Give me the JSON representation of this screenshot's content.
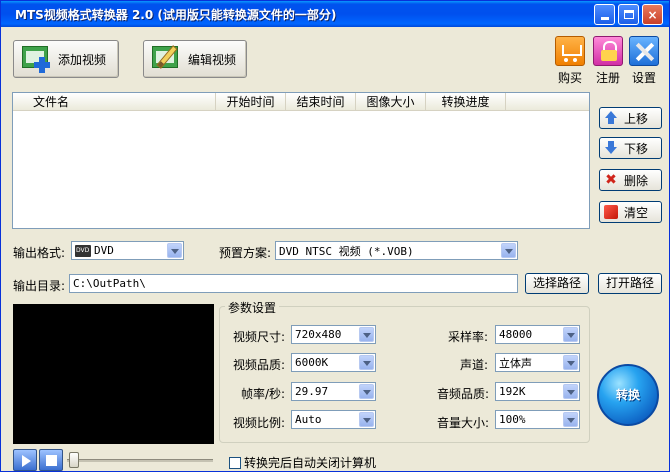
{
  "window": {
    "title": "MTS视频格式转换器 2.0 (试用版只能转换源文件的一部分)",
    "controls": {
      "minimize": "",
      "maximize": "",
      "close": "×"
    }
  },
  "toolbar": {
    "add_video": "添加视频",
    "edit_video": "编辑视频",
    "buy": "购买",
    "register": "注册",
    "settings": "设置"
  },
  "filelist": {
    "columns": [
      "文件名",
      "开始时间",
      "结束时间",
      "图像大小",
      "转换进度"
    ],
    "rows": []
  },
  "side_buttons": {
    "up": "上移",
    "down": "下移",
    "delete": "删除",
    "clear": "清空"
  },
  "output": {
    "format_label": "输出格式:",
    "format_value": "DVD",
    "preset_label": "预置方案:",
    "preset_value": "DVD NTSC 视频  (*.VOB)",
    "dir_label": "输出目录:",
    "dir_value": "C:\\OutPath\\",
    "choose_path": "选择路径",
    "open_path": "打开路径"
  },
  "params": {
    "title": "参数设置",
    "video_size_label": "视频尺寸:",
    "video_size": "720x480",
    "video_quality_label": "视频品质:",
    "video_quality": "6000K",
    "framerate_label": "帧率/秒:",
    "framerate": "29.97",
    "aspect_label": "视频比例:",
    "aspect": "Auto",
    "samplerate_label": "采样率:",
    "samplerate": "48000",
    "channels_label": "声道:",
    "channels": "立体声",
    "audio_quality_label": "音频品质:",
    "audio_quality": "192K",
    "volume_label": "音量大小:",
    "volume": "100%"
  },
  "convert_label": "转换",
  "player": {
    "seek_position": 0
  },
  "shutdown_checkbox": {
    "label": "转换完后自动关闭计算机",
    "checked": false
  },
  "colors": {
    "title_bar": "#0053ee",
    "window_bg": "#ece9d8",
    "convert_button": "#27a3f0"
  }
}
